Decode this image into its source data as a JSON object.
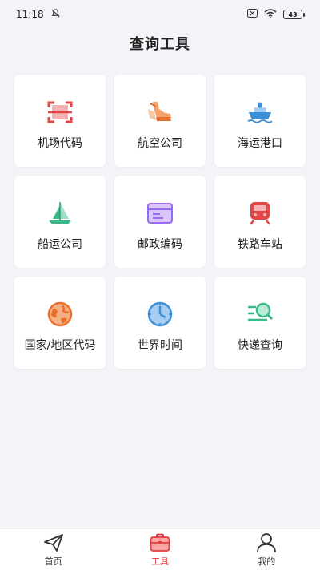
{
  "status_bar": {
    "time": "11:18",
    "battery": "43"
  },
  "header": {
    "title": "查询工具"
  },
  "tools": [
    {
      "label": "机场代码",
      "icon": "scan-icon"
    },
    {
      "label": "航空公司",
      "icon": "boot-icon"
    },
    {
      "label": "海运港口",
      "icon": "ship-icon"
    },
    {
      "label": "船运公司",
      "icon": "sail-icon"
    },
    {
      "label": "邮政编码",
      "icon": "mail-card-icon"
    },
    {
      "label": "铁路车站",
      "icon": "train-icon"
    },
    {
      "label": "国家/地区代码",
      "icon": "globe-icon"
    },
    {
      "label": "世界时间",
      "icon": "clock-icon"
    },
    {
      "label": "快递查询",
      "icon": "search-list-icon"
    }
  ],
  "tabbar": {
    "items": [
      {
        "label": "首页",
        "icon": "paper-plane-icon"
      },
      {
        "label": "工具",
        "icon": "toolbox-icon",
        "active": true
      },
      {
        "label": "我的",
        "icon": "person-icon"
      }
    ]
  },
  "colors": {
    "accent": "#e43d3d",
    "background": "#f3f4f8"
  }
}
